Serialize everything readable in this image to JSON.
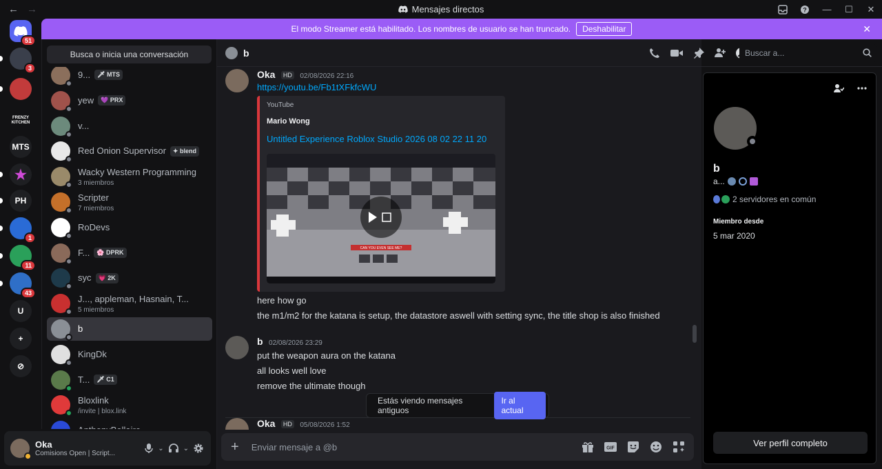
{
  "window": {
    "title": "Mensajes directos"
  },
  "banner": {
    "text": "El modo Streamer está habilitado. Los nombres de usuario se han truncado.",
    "button": "Deshabilitar"
  },
  "servers": [
    {
      "label": "",
      "badge": "51",
      "color": "#5865f2",
      "icon": "discord-icon"
    },
    {
      "label": "",
      "badge": "3",
      "color": "#3a3f4b",
      "icon": "server-icon"
    },
    {
      "label": "",
      "badge": "",
      "color": "#c23b3b",
      "icon": "server-icon"
    },
    {
      "label": "FRENZY KITCHEN",
      "badge": "",
      "color": "#121214",
      "icon": "server-icon"
    },
    {
      "label": "MTS",
      "badge": "",
      "color": "#1e1f22",
      "icon": "server-icon"
    },
    {
      "label": "★",
      "badge": "",
      "color": "#1e1f22",
      "icon": "star-icon"
    },
    {
      "label": "PH",
      "badge": "",
      "color": "#1e1f22",
      "icon": "server-icon"
    },
    {
      "label": "",
      "badge": "1",
      "color": "#2a6bd6",
      "icon": "server-icon"
    },
    {
      "label": "",
      "badge": "11",
      "color": "#2aa05a",
      "icon": "server-icon"
    },
    {
      "label": "",
      "badge": "43",
      "color": "#2f6fc7",
      "icon": "server-icon"
    },
    {
      "label": "U",
      "badge": "",
      "color": "#1e1f22",
      "icon": "server-icon"
    },
    {
      "label": "+",
      "badge": "",
      "color": "#1e1f22",
      "icon": "add-server-icon"
    },
    {
      "label": "⊘",
      "badge": "",
      "color": "#1e1f22",
      "icon": "explore-icon"
    }
  ],
  "dm_search": "Busca o inicia una conversación",
  "dms": [
    {
      "name": "9...",
      "tag": "🗡 MTS",
      "sub": "",
      "online": false,
      "avatar": "#8b6f5c"
    },
    {
      "name": "yew",
      "tag": "💜 PRX",
      "sub": "",
      "online": false,
      "avatar": "#a0524b"
    },
    {
      "name": "v...",
      "tag": "",
      "sub": "",
      "online": false,
      "avatar": "#6c8a7c"
    },
    {
      "name": "Red Onion Supervisor",
      "tag": "✦ blend",
      "sub": "",
      "online": false,
      "avatar": "#e8e8e8"
    },
    {
      "name": "Wacky Western Programming",
      "tag": "",
      "sub": "3 miembros",
      "online": false,
      "avatar": "#9a8a6a"
    },
    {
      "name": "Scripter",
      "tag": "",
      "sub": "7 miembros",
      "online": false,
      "avatar": "#c4702a"
    },
    {
      "name": "RoDevs",
      "tag": "",
      "sub": "",
      "online": false,
      "avatar": "#ffffff"
    },
    {
      "name": "F...",
      "tag": "🌸 DPRK",
      "sub": "",
      "online": false,
      "avatar": "#8a6a5a"
    },
    {
      "name": "syc",
      "tag": "💗 2K",
      "sub": "",
      "online": false,
      "avatar": "#1e3a4a"
    },
    {
      "name": "J..., appleman, Hasnain, T...",
      "tag": "",
      "sub": "5 miembros",
      "online": false,
      "avatar": "#c83030"
    },
    {
      "name": "b",
      "tag": "",
      "sub": "",
      "online": false,
      "avatar": "#8a8f96"
    },
    {
      "name": "KingDk",
      "tag": "",
      "sub": "",
      "online": false,
      "avatar": "#e0e0e0"
    },
    {
      "name": "T...",
      "tag": "🗡 C1",
      "sub": "",
      "online": true,
      "avatar": "#5a7a4a"
    },
    {
      "name": "Bloxlink",
      "tag": "",
      "sub": "/invite | blox.link",
      "online": true,
      "avatar": "#e03a3a"
    },
    {
      "name": "AnthonyBellaire",
      "tag": "",
      "sub": "",
      "online": false,
      "avatar": "#2a4ad6"
    }
  ],
  "user": {
    "name": "Oka",
    "status": "Comisions Open | Script..."
  },
  "chat": {
    "name": "b",
    "search_placeholder": "Buscar a...",
    "composer_placeholder": "Enviar mensaje a @b",
    "jump_text": "Estás viendo mensajes antiguos",
    "jump_button": "Ir al actual"
  },
  "messages": [
    {
      "author": "Oka",
      "badge": "HD",
      "time": "02/08/2026 22:16",
      "link": "https://youtu.be/Fb1tXFkfcWU",
      "embed": {
        "provider": "YouTube",
        "author": "Mario Wong",
        "title": "Untitled Experience   Roblox Studio 2026 08 02 22 11 20",
        "video_caption": "CAN YOU EVEN SEE ME?"
      },
      "lines": [
        "here how go",
        "the m1/m2 for the katana is setup, the datastore aswell with setting sync, the title shop is also finished"
      ]
    },
    {
      "author": "b",
      "badge": "",
      "time": "02/08/2026 23:29",
      "lines": [
        "put the weapon aura on the katana",
        "all looks well love",
        "remove the ultimate though"
      ]
    },
    {
      "author": "Oka",
      "badge": "HD",
      "time": "05/08/2026 1:52",
      "lines": []
    }
  ],
  "profile": {
    "name": "b",
    "subtitle": "a...",
    "mutual": "2 servidores en común",
    "member_label": "Miembro desde",
    "member_date": "5 mar 2020",
    "button": "Ver perfil completo"
  },
  "colors": {
    "accent": "#5865f2",
    "banner": "#9b5cf6",
    "link": "#00a8fc",
    "online": "#23a55a",
    "danger": "#da373c"
  }
}
